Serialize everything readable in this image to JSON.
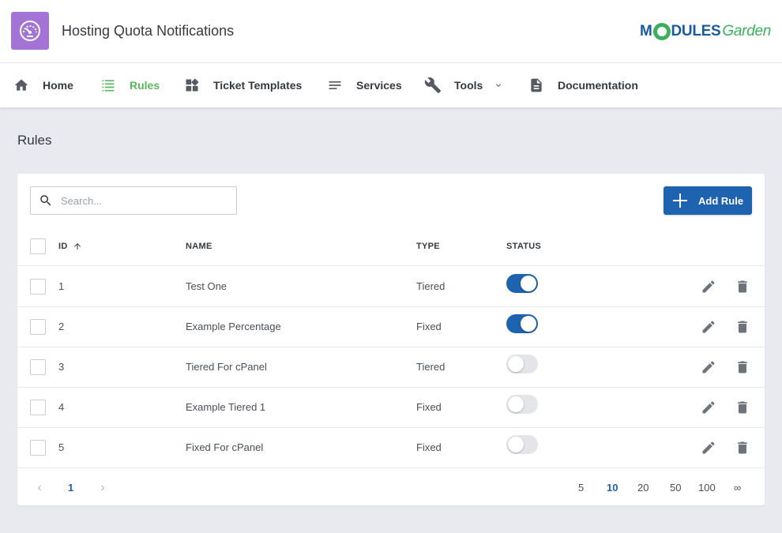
{
  "app": {
    "title": "Hosting Quota Notifications",
    "icon": "speedometer-icon"
  },
  "brand": {
    "part1": "M",
    "part2": "DULES",
    "part3": "Garden"
  },
  "nav": {
    "home": "Home",
    "rules": "Rules",
    "ticket_templates": "Ticket Templates",
    "services": "Services",
    "tools": "Tools",
    "documentation": "Documentation"
  },
  "page": {
    "title": "Rules"
  },
  "search": {
    "placeholder": "Search..."
  },
  "toolbar": {
    "add_label": "Add Rule"
  },
  "table": {
    "columns": {
      "id": "ID",
      "name": "NAME",
      "type": "TYPE",
      "status": "STATUS"
    },
    "rows": [
      {
        "id": "1",
        "name": "Test One",
        "type": "Tiered",
        "status": true
      },
      {
        "id": "2",
        "name": "Example Percentage",
        "type": "Fixed",
        "status": true
      },
      {
        "id": "3",
        "name": "Tiered For cPanel",
        "type": "Tiered",
        "status": false
      },
      {
        "id": "4",
        "name": "Example Tiered 1",
        "type": "Fixed",
        "status": false
      },
      {
        "id": "5",
        "name": "Fixed For cPanel",
        "type": "Fixed",
        "status": false
      }
    ]
  },
  "pagination": {
    "current_page": "1",
    "page_sizes": [
      "5",
      "10",
      "20",
      "50",
      "100",
      "∞"
    ],
    "selected_size": "10"
  },
  "colors": {
    "accent": "#1e63b0",
    "active_nav": "#58b85c",
    "app_icon": "#a473d6"
  }
}
